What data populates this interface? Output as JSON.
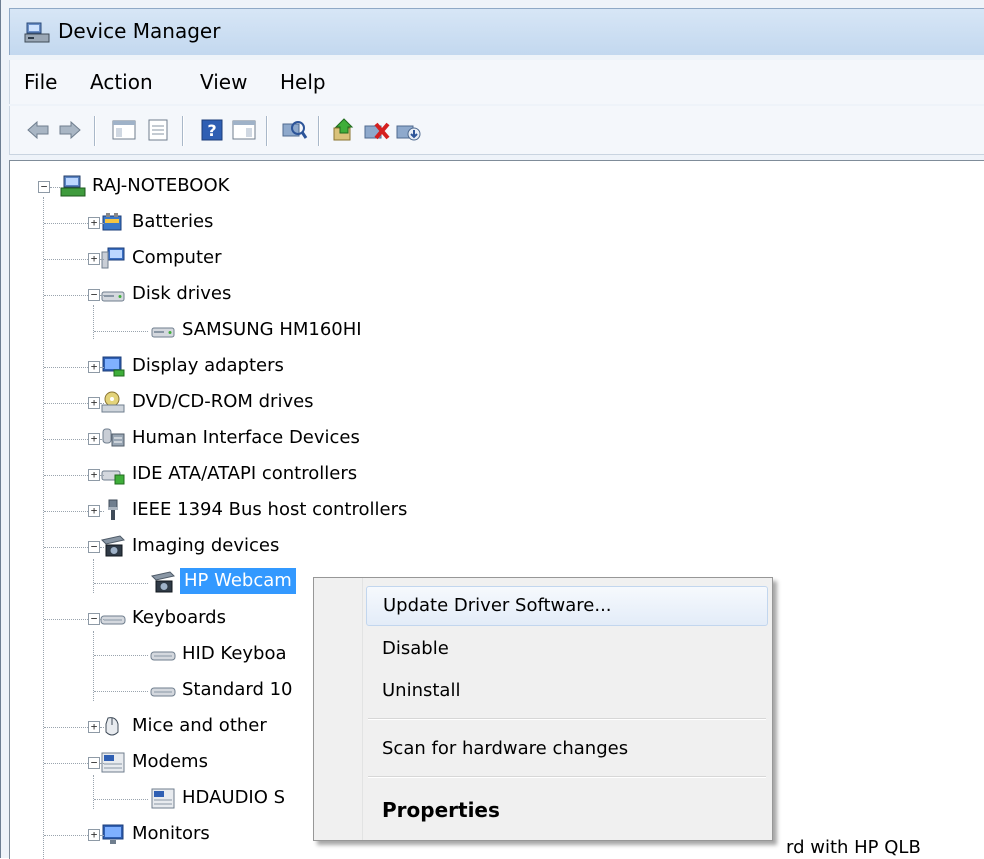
{
  "window": {
    "title": "Device Manager"
  },
  "menubar": {
    "items": [
      "File",
      "Action",
      "View",
      "Help"
    ]
  },
  "toolbar": {
    "buttons": [
      "back-icon",
      "forward-icon",
      "show-hide-console-tree-icon",
      "properties-icon",
      "help-icon",
      "show-action-pane-icon",
      "scan-hardware-icon",
      "update-driver-icon",
      "uninstall-icon",
      "enable-icon"
    ]
  },
  "tree": {
    "root": "RAJ-NOTEBOOK",
    "nodes": [
      {
        "label": "Batteries",
        "icon": "battery-icon",
        "expanded": false
      },
      {
        "label": "Computer",
        "icon": "computer-icon",
        "expanded": false
      },
      {
        "label": "Disk drives",
        "icon": "disk-drive-icon",
        "expanded": true
      },
      {
        "label": "SAMSUNG HM160HI",
        "icon": "disk-drive-icon",
        "child": true
      },
      {
        "label": "Display adapters",
        "icon": "display-adapter-icon",
        "expanded": false
      },
      {
        "label": "DVD/CD-ROM drives",
        "icon": "dvd-drive-icon",
        "expanded": false
      },
      {
        "label": "Human Interface Devices",
        "icon": "hid-icon",
        "expanded": false
      },
      {
        "label": "IDE ATA/ATAPI controllers",
        "icon": "ide-controller-icon",
        "expanded": false
      },
      {
        "label": "IEEE 1394 Bus host controllers",
        "icon": "firewire-icon",
        "expanded": false
      },
      {
        "label": "Imaging devices",
        "icon": "camera-icon",
        "expanded": true
      },
      {
        "label": "HP Webcam",
        "icon": "camera-icon",
        "child": true,
        "selected": true
      },
      {
        "label": "Keyboards",
        "icon": "keyboard-icon",
        "expanded": true
      },
      {
        "label": "HID Keyboa",
        "icon": "keyboard-icon",
        "child": true
      },
      {
        "label": "Standard 10",
        "icon": "keyboard-icon",
        "child": true
      },
      {
        "label": "Mice and other",
        "icon": "mouse-icon",
        "expanded": false
      },
      {
        "label": "Modems",
        "icon": "modem-icon",
        "expanded": true
      },
      {
        "label": "HDAUDIO S",
        "icon": "modem-icon",
        "child": true
      },
      {
        "label": "Monitors",
        "icon": "monitor-icon",
        "expanded": false
      }
    ],
    "partial_text": "rd with HP QLB"
  },
  "context_menu": {
    "items": [
      {
        "label": "Update Driver Software...",
        "hover": true
      },
      {
        "label": "Disable"
      },
      {
        "label": "Uninstall"
      },
      {
        "label": "Scan for hardware changes"
      },
      {
        "label": "Properties",
        "bold": true
      }
    ]
  },
  "colors": {
    "selection": "#3399ff",
    "titlebar": "#c3d8ef",
    "menu_hover": "#e3ecf8"
  }
}
